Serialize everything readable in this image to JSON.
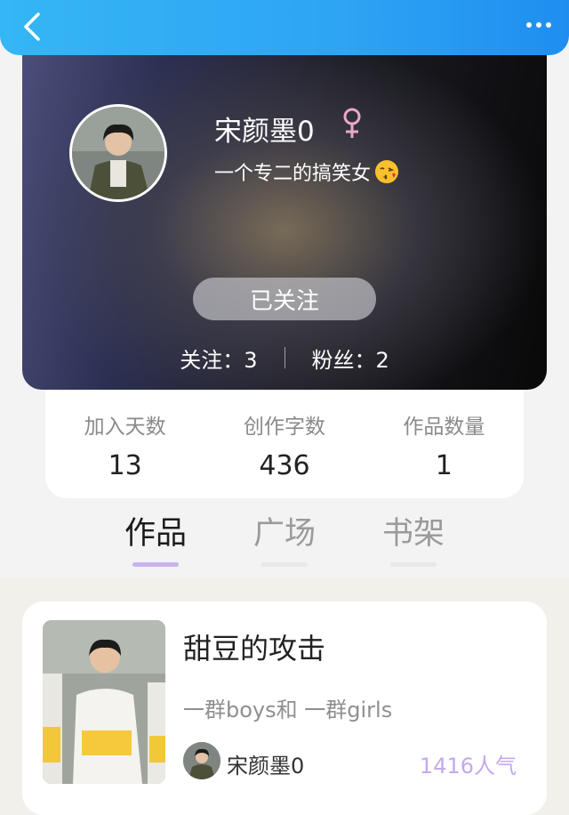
{
  "profile": {
    "username": "宋颜墨0",
    "gender_icon": "female-symbol",
    "bio": "一个专二的搞笑女",
    "bio_emoji": "kissing-face-with-heart",
    "follow_button": "已关注",
    "following_label": "关注：3",
    "followers_label": "粉丝：2"
  },
  "stats": [
    {
      "label": "加入天数",
      "value": "13"
    },
    {
      "label": "创作字数",
      "value": "436"
    },
    {
      "label": "作品数量",
      "value": "1"
    }
  ],
  "tabs": [
    {
      "label": "作品",
      "active": true
    },
    {
      "label": "广场",
      "active": false
    },
    {
      "label": "书架",
      "active": false
    }
  ],
  "works": [
    {
      "title": "甜豆的攻击",
      "description": "一群boys和  一群girls",
      "author": "宋颜墨0",
      "popularity": "1416人气"
    }
  ],
  "colors": {
    "header": "#2ea4f3",
    "tab_active_underline": "#c9b3ec",
    "popularity": "#c3a9ee",
    "gender": "#e8a9c8"
  }
}
